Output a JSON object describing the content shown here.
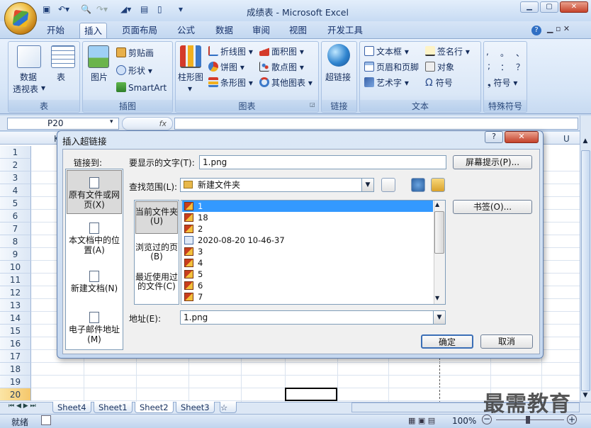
{
  "window": {
    "title": "成绩表 - Microsoft Excel"
  },
  "ribbon": {
    "tabs": [
      "开始",
      "插入",
      "页面布局",
      "公式",
      "数据",
      "审阅",
      "视图",
      "开发工具"
    ],
    "active_tab": "插入",
    "groups": {
      "tables": {
        "label": "表",
        "pivot": "数据",
        "pivot2": "透视表",
        "table": "表"
      },
      "illustrations": {
        "label": "插图",
        "picture": "图片",
        "clipart": "剪贴画",
        "shapes": "形状",
        "smartart": "SmartArt"
      },
      "charts": {
        "label": "图表",
        "column": "柱形图",
        "line": "折线图",
        "pie": "饼图",
        "bar": "条形图",
        "area": "面积图",
        "scatter": "散点图",
        "other": "其他图表"
      },
      "links": {
        "label": "链接",
        "hyperlink": "超链接"
      },
      "text": {
        "label": "文本",
        "textbox": "文本框",
        "header": "页眉和页脚",
        "wordart": "艺术字",
        "signature": "签名行",
        "object": "对象",
        "symbol": "符号"
      },
      "special": {
        "label": "特殊符号",
        "symbol": "符号",
        "chars": [
          ",",
          "。",
          "、",
          ";",
          "：",
          "？"
        ]
      }
    }
  },
  "formula_bar": {
    "name_box": "P20",
    "fx": "fx",
    "content": ""
  },
  "sheet": {
    "rows": [
      "1",
      "2",
      "3",
      "4",
      "5",
      "6",
      "7",
      "8",
      "9",
      "10",
      "11",
      "12",
      "13",
      "14",
      "15",
      "16",
      "17",
      "18",
      "19",
      "20"
    ],
    "col_k": "K",
    "col_u": "U",
    "tabs": [
      "Sheet4",
      "Sheet1",
      "Sheet2",
      "Sheet3"
    ],
    "active_tab": "Sheet2"
  },
  "status": {
    "ready": "就绪",
    "zoom": "100%"
  },
  "dialog": {
    "title": "插入超链接",
    "link_to_label": "链接到:",
    "nav": [
      {
        "label": "原有文件或网页(X)",
        "active": true
      },
      {
        "label": "本文档中的位置(A)"
      },
      {
        "label": "新建文档(N)"
      },
      {
        "label": "电子邮件地址(M)"
      }
    ],
    "display_text_label": "要显示的文字(T):",
    "display_text": "1.png",
    "screentip_button": "屏幕提示(P)...",
    "lookin_label": "查找范围(L):",
    "lookin_value": "新建文件夹",
    "subnav": [
      "当前文件夹(U)",
      "浏览过的页(B)",
      "最近使用过的文件(C)"
    ],
    "files": [
      "1",
      "18",
      "2",
      "2020-08-20 10-46-37",
      "3",
      "4",
      "5",
      "6",
      "7"
    ],
    "selected_file": "1",
    "bookmark_button": "书签(O)...",
    "address_label": "地址(E):",
    "address": "1.png",
    "ok": "确定",
    "cancel": "取消"
  },
  "watermark": "最需教育"
}
